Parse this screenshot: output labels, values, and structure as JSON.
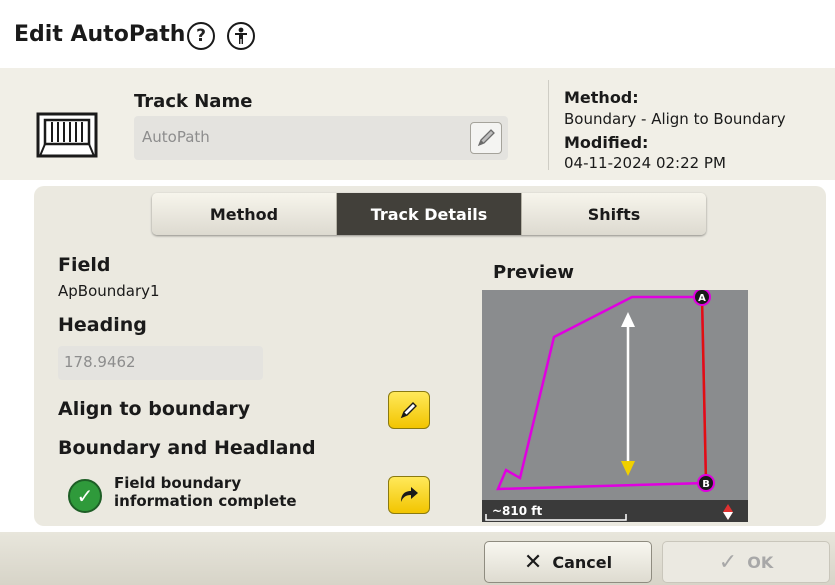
{
  "header": {
    "title": "Edit AutoPath",
    "help_icon": "?",
    "info_icon": "i"
  },
  "track": {
    "name_label": "Track Name",
    "name_value": "AutoPath",
    "method_label": "Method:",
    "method_value": "Boundary - Align to Boundary",
    "modified_label": "Modified:",
    "modified_value": "04-11-2024 02:22 PM"
  },
  "tabs": [
    {
      "label": "Method",
      "active": false
    },
    {
      "label": "Track Details",
      "active": true
    },
    {
      "label": "Shifts",
      "active": false
    }
  ],
  "details": {
    "field_label": "Field",
    "field_value": "ApBoundary1",
    "heading_label": "Heading",
    "heading_value": "178.9462",
    "align_label": "Align to boundary",
    "boundary_label": "Boundary and Headland",
    "status_text_line1": "Field boundary",
    "status_text_line2": "information complete"
  },
  "preview": {
    "title": "Preview",
    "scale_text": "~810 ft",
    "point_a": "A",
    "point_b": "B",
    "colors": {
      "boundary": "#e000e0",
      "track": "#e01010",
      "arrow": "#ffffff",
      "arrow_tip": "#f0d000"
    }
  },
  "footer": {
    "cancel_label": "Cancel",
    "ok_label": "OK"
  }
}
